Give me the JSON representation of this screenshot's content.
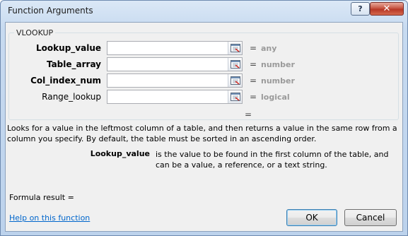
{
  "window": {
    "title": "Function Arguments",
    "help_glyph": "?",
    "close_glyph": "✕"
  },
  "function_group": {
    "name": "VLOOKUP",
    "arguments": [
      {
        "label": "Lookup_value",
        "value": "",
        "equals": "=",
        "result": "any"
      },
      {
        "label": "Table_array",
        "value": "",
        "equals": "=",
        "result": "number"
      },
      {
        "label": "Col_index_num",
        "value": "",
        "equals": "=",
        "result": "number"
      },
      {
        "label": "Range_lookup",
        "value": "",
        "equals": "=",
        "result": "logical"
      }
    ]
  },
  "function_result_equals": "=",
  "description": "Looks for a value in the leftmost column of a table, and then returns a value in the same row from a column you specify. By default, the table must be sorted in an ascending order.",
  "argument_help": {
    "name": "Lookup_value",
    "text": "is the value to be found in the first column of the table, and can be a value, a reference, or a text string."
  },
  "formula_result_label": "Formula result =",
  "help_link": "Help on this function",
  "buttons": {
    "ok": "OK",
    "cancel": "Cancel"
  },
  "icons": {
    "collapse": "collapse-dialog-icon"
  }
}
